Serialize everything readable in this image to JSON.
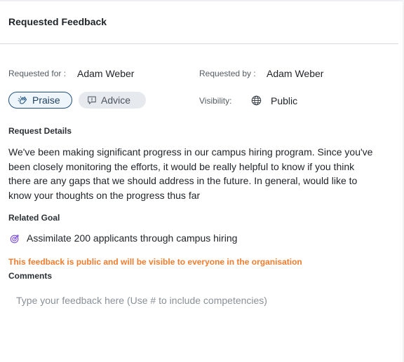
{
  "header": {
    "title": "Requested Feedback"
  },
  "meta": {
    "requested_for_label": "Requested for :",
    "requested_for_value": "Adam Weber",
    "requested_by_label": "Requested by :",
    "requested_by_value": "Adam Weber",
    "visibility_label": "Visibility:",
    "visibility_value": "Public",
    "visibility_icon": "globe-icon"
  },
  "feedback_types": [
    {
      "label": "Praise",
      "icon": "clapping-hands-icon",
      "selected": true
    },
    {
      "label": "Advice",
      "icon": "speech-bubble-icon",
      "selected": false
    }
  ],
  "request_details": {
    "title": "Request Details",
    "lines": [
      "We've been making significant progress in our campus hiring program. Since you've",
      "been closely monitoring the efforts, it would be really helpful to know if you think",
      "there are any gaps that we should address in the future. In general, would like to",
      "know your thoughts on the progress thus far"
    ]
  },
  "related_goal": {
    "title": "Related Goal",
    "icon": "goal-target-icon",
    "text": "Assimilate 200 applicants through campus hiring"
  },
  "notice": {
    "text": "This feedback is public and will be visible to everyone in the organisation"
  },
  "comments": {
    "title": "Comments",
    "value": "",
    "placeholder": "Type your feedback here (Use # to include competencies)"
  },
  "colors": {
    "accent": "#1f4f7a",
    "warning": "#f07c2f",
    "divider": "#d8dbe0"
  }
}
